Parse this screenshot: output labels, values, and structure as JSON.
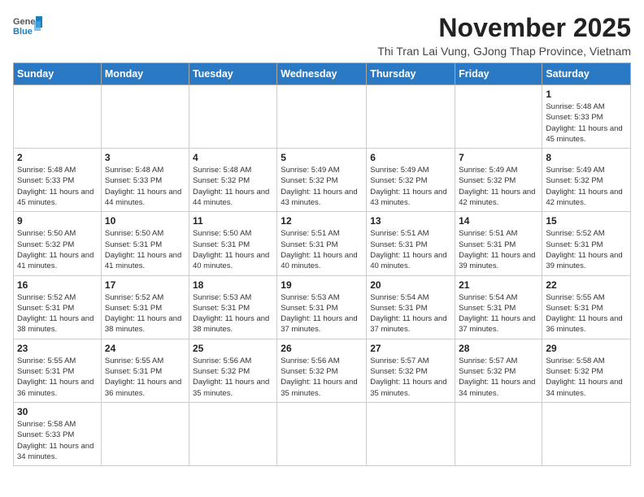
{
  "logo": {
    "general": "General",
    "blue": "Blue"
  },
  "title": "November 2025",
  "subtitle": "Thi Tran Lai Vung, GJong Thap Province, Vietnam",
  "days_of_week": [
    "Sunday",
    "Monday",
    "Tuesday",
    "Wednesday",
    "Thursday",
    "Friday",
    "Saturday"
  ],
  "weeks": [
    [
      null,
      null,
      null,
      null,
      null,
      null,
      {
        "day": "1",
        "sunrise": "5:48 AM",
        "sunset": "5:33 PM",
        "daylight": "11 hours and 45 minutes."
      }
    ],
    [
      {
        "day": "2",
        "sunrise": "5:48 AM",
        "sunset": "5:33 PM",
        "daylight": "11 hours and 45 minutes."
      },
      {
        "day": "3",
        "sunrise": "5:48 AM",
        "sunset": "5:33 PM",
        "daylight": "11 hours and 44 minutes."
      },
      {
        "day": "4",
        "sunrise": "5:48 AM",
        "sunset": "5:32 PM",
        "daylight": "11 hours and 44 minutes."
      },
      {
        "day": "5",
        "sunrise": "5:49 AM",
        "sunset": "5:32 PM",
        "daylight": "11 hours and 43 minutes."
      },
      {
        "day": "6",
        "sunrise": "5:49 AM",
        "sunset": "5:32 PM",
        "daylight": "11 hours and 43 minutes."
      },
      {
        "day": "7",
        "sunrise": "5:49 AM",
        "sunset": "5:32 PM",
        "daylight": "11 hours and 42 minutes."
      },
      {
        "day": "8",
        "sunrise": "5:49 AM",
        "sunset": "5:32 PM",
        "daylight": "11 hours and 42 minutes."
      }
    ],
    [
      {
        "day": "9",
        "sunrise": "5:50 AM",
        "sunset": "5:32 PM",
        "daylight": "11 hours and 41 minutes."
      },
      {
        "day": "10",
        "sunrise": "5:50 AM",
        "sunset": "5:31 PM",
        "daylight": "11 hours and 41 minutes."
      },
      {
        "day": "11",
        "sunrise": "5:50 AM",
        "sunset": "5:31 PM",
        "daylight": "11 hours and 40 minutes."
      },
      {
        "day": "12",
        "sunrise": "5:51 AM",
        "sunset": "5:31 PM",
        "daylight": "11 hours and 40 minutes."
      },
      {
        "day": "13",
        "sunrise": "5:51 AM",
        "sunset": "5:31 PM",
        "daylight": "11 hours and 40 minutes."
      },
      {
        "day": "14",
        "sunrise": "5:51 AM",
        "sunset": "5:31 PM",
        "daylight": "11 hours and 39 minutes."
      },
      {
        "day": "15",
        "sunrise": "5:52 AM",
        "sunset": "5:31 PM",
        "daylight": "11 hours and 39 minutes."
      }
    ],
    [
      {
        "day": "16",
        "sunrise": "5:52 AM",
        "sunset": "5:31 PM",
        "daylight": "11 hours and 38 minutes."
      },
      {
        "day": "17",
        "sunrise": "5:52 AM",
        "sunset": "5:31 PM",
        "daylight": "11 hours and 38 minutes."
      },
      {
        "day": "18",
        "sunrise": "5:53 AM",
        "sunset": "5:31 PM",
        "daylight": "11 hours and 38 minutes."
      },
      {
        "day": "19",
        "sunrise": "5:53 AM",
        "sunset": "5:31 PM",
        "daylight": "11 hours and 37 minutes."
      },
      {
        "day": "20",
        "sunrise": "5:54 AM",
        "sunset": "5:31 PM",
        "daylight": "11 hours and 37 minutes."
      },
      {
        "day": "21",
        "sunrise": "5:54 AM",
        "sunset": "5:31 PM",
        "daylight": "11 hours and 37 minutes."
      },
      {
        "day": "22",
        "sunrise": "5:55 AM",
        "sunset": "5:31 PM",
        "daylight": "11 hours and 36 minutes."
      }
    ],
    [
      {
        "day": "23",
        "sunrise": "5:55 AM",
        "sunset": "5:31 PM",
        "daylight": "11 hours and 36 minutes."
      },
      {
        "day": "24",
        "sunrise": "5:55 AM",
        "sunset": "5:31 PM",
        "daylight": "11 hours and 36 minutes."
      },
      {
        "day": "25",
        "sunrise": "5:56 AM",
        "sunset": "5:32 PM",
        "daylight": "11 hours and 35 minutes."
      },
      {
        "day": "26",
        "sunrise": "5:56 AM",
        "sunset": "5:32 PM",
        "daylight": "11 hours and 35 minutes."
      },
      {
        "day": "27",
        "sunrise": "5:57 AM",
        "sunset": "5:32 PM",
        "daylight": "11 hours and 35 minutes."
      },
      {
        "day": "28",
        "sunrise": "5:57 AM",
        "sunset": "5:32 PM",
        "daylight": "11 hours and 34 minutes."
      },
      {
        "day": "29",
        "sunrise": "5:58 AM",
        "sunset": "5:32 PM",
        "daylight": "11 hours and 34 minutes."
      }
    ],
    [
      {
        "day": "30",
        "sunrise": "5:58 AM",
        "sunset": "5:33 PM",
        "daylight": "11 hours and 34 minutes."
      },
      null,
      null,
      null,
      null,
      null,
      null
    ]
  ]
}
